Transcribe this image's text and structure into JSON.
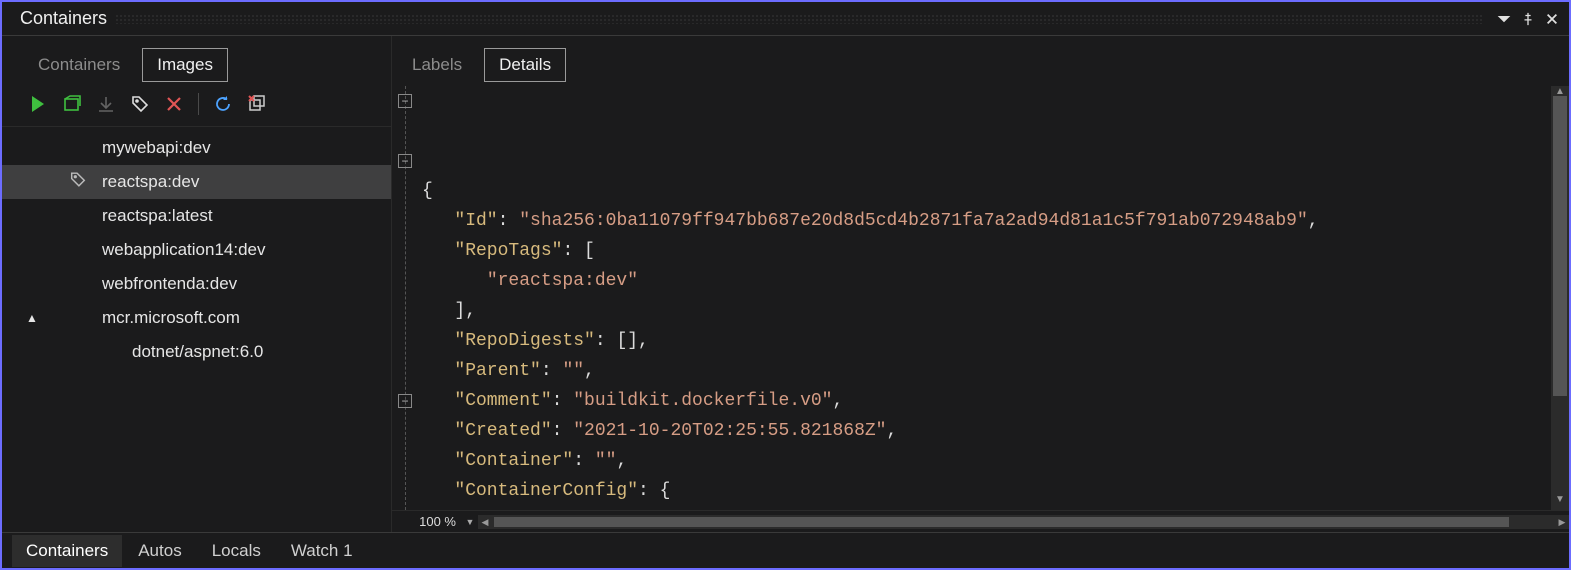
{
  "window": {
    "title": "Containers"
  },
  "left": {
    "tabs": [
      {
        "label": "Containers",
        "active": false
      },
      {
        "label": "Images",
        "active": true
      }
    ],
    "images": [
      {
        "label": "mywebapi:dev",
        "level": 1,
        "selected": false,
        "hasTag": false
      },
      {
        "label": "reactspa:dev",
        "level": 1,
        "selected": true,
        "hasTag": true
      },
      {
        "label": "reactspa:latest",
        "level": 1,
        "selected": false,
        "hasTag": false
      },
      {
        "label": "webapplication14:dev",
        "level": 1,
        "selected": false,
        "hasTag": false
      },
      {
        "label": "webfrontenda:dev",
        "level": 1,
        "selected": false,
        "hasTag": false
      },
      {
        "label": "mcr.microsoft.com",
        "level": 0,
        "selected": false,
        "expander": "▲",
        "isFolder": true
      },
      {
        "label": "dotnet/aspnet:6.0",
        "level": 2,
        "selected": false,
        "hasTag": false
      }
    ]
  },
  "right": {
    "tabs": [
      {
        "label": "Labels",
        "active": false
      },
      {
        "label": "Details",
        "active": true
      }
    ],
    "zoom": "100 %",
    "json": {
      "Id": "sha256:0ba11079ff947bb687e20d8d5cd4b2871fa7a2ad94d81a1c5f791ab072948ab9",
      "RepoTags": [
        "reactspa:dev"
      ],
      "RepoDigests": [],
      "Parent": "",
      "Comment": "buildkit.dockerfile.v0",
      "Created": "2021-10-20T02:25:55.821868Z",
      "Container": "",
      "ContainerConfig": {
        "Hostname": "",
        "Domainname": ""
      }
    }
  },
  "bottom_tabs": [
    {
      "label": "Containers",
      "active": true
    },
    {
      "label": "Autos",
      "active": false
    },
    {
      "label": "Locals",
      "active": false
    },
    {
      "label": "Watch 1",
      "active": false
    }
  ]
}
